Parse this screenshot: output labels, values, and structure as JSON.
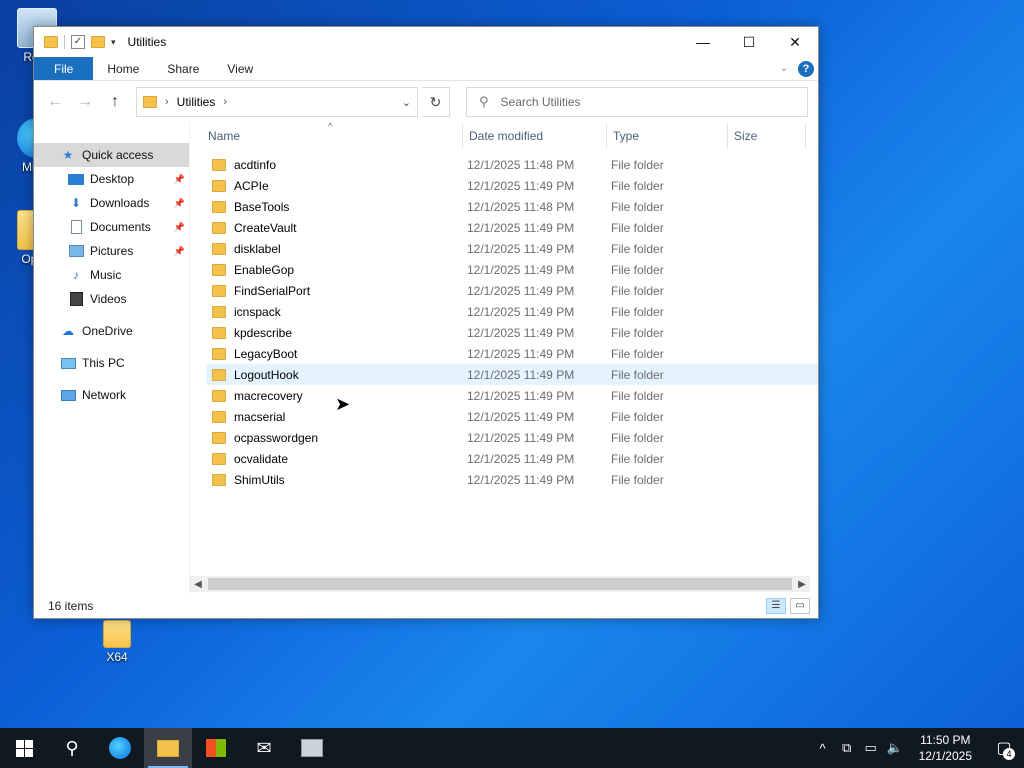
{
  "desktop": {
    "icons": [
      {
        "label": "Recy"
      },
      {
        "label": "Mic E"
      },
      {
        "label": "OpCo"
      },
      {
        "label": "X64"
      }
    ]
  },
  "window": {
    "title": "Utilities",
    "controls": {
      "minimize": "—",
      "maximize": "☐",
      "close": "✕"
    }
  },
  "ribbon": {
    "tabs": [
      "File",
      "Home",
      "Share",
      "View"
    ],
    "help": "?"
  },
  "address": {
    "path": [
      "Utilities"
    ],
    "search_placeholder": "Search Utilities"
  },
  "nav_pane": {
    "quick_access": "Quick access",
    "pinned": [
      "Desktop",
      "Downloads",
      "Documents",
      "Pictures"
    ],
    "unpinned": [
      "Music",
      "Videos"
    ],
    "onedrive": "OneDrive",
    "this_pc": "This PC",
    "network": "Network"
  },
  "columns": {
    "name": "Name",
    "date": "Date modified",
    "type": "Type",
    "size": "Size"
  },
  "files": [
    {
      "name": "acdtinfo",
      "date": "12/1/2025 11:48 PM",
      "type": "File folder"
    },
    {
      "name": "ACPIe",
      "date": "12/1/2025 11:49 PM",
      "type": "File folder"
    },
    {
      "name": "BaseTools",
      "date": "12/1/2025 11:48 PM",
      "type": "File folder"
    },
    {
      "name": "CreateVault",
      "date": "12/1/2025 11:49 PM",
      "type": "File folder"
    },
    {
      "name": "disklabel",
      "date": "12/1/2025 11:49 PM",
      "type": "File folder"
    },
    {
      "name": "EnableGop",
      "date": "12/1/2025 11:49 PM",
      "type": "File folder"
    },
    {
      "name": "FindSerialPort",
      "date": "12/1/2025 11:49 PM",
      "type": "File folder"
    },
    {
      "name": "icnspack",
      "date": "12/1/2025 11:49 PM",
      "type": "File folder"
    },
    {
      "name": "kpdescribe",
      "date": "12/1/2025 11:49 PM",
      "type": "File folder"
    },
    {
      "name": "LegacyBoot",
      "date": "12/1/2025 11:49 PM",
      "type": "File folder"
    },
    {
      "name": "LogoutHook",
      "date": "12/1/2025 11:49 PM",
      "type": "File folder"
    },
    {
      "name": "macrecovery",
      "date": "12/1/2025 11:49 PM",
      "type": "File folder"
    },
    {
      "name": "macserial",
      "date": "12/1/2025 11:49 PM",
      "type": "File folder"
    },
    {
      "name": "ocpasswordgen",
      "date": "12/1/2025 11:49 PM",
      "type": "File folder"
    },
    {
      "name": "ocvalidate",
      "date": "12/1/2025 11:49 PM",
      "type": "File folder"
    },
    {
      "name": "ShimUtils",
      "date": "12/1/2025 11:49 PM",
      "type": "File folder"
    }
  ],
  "status": {
    "item_count": "16 items"
  },
  "taskbar": {
    "time": "11:50 PM",
    "date": "12/1/2025",
    "notification_count": "4"
  },
  "colors": {
    "accent": "#1a6fbf",
    "folder": "#f4c24a",
    "hover_row": "#e5f3ff",
    "taskbar": "#101820"
  }
}
